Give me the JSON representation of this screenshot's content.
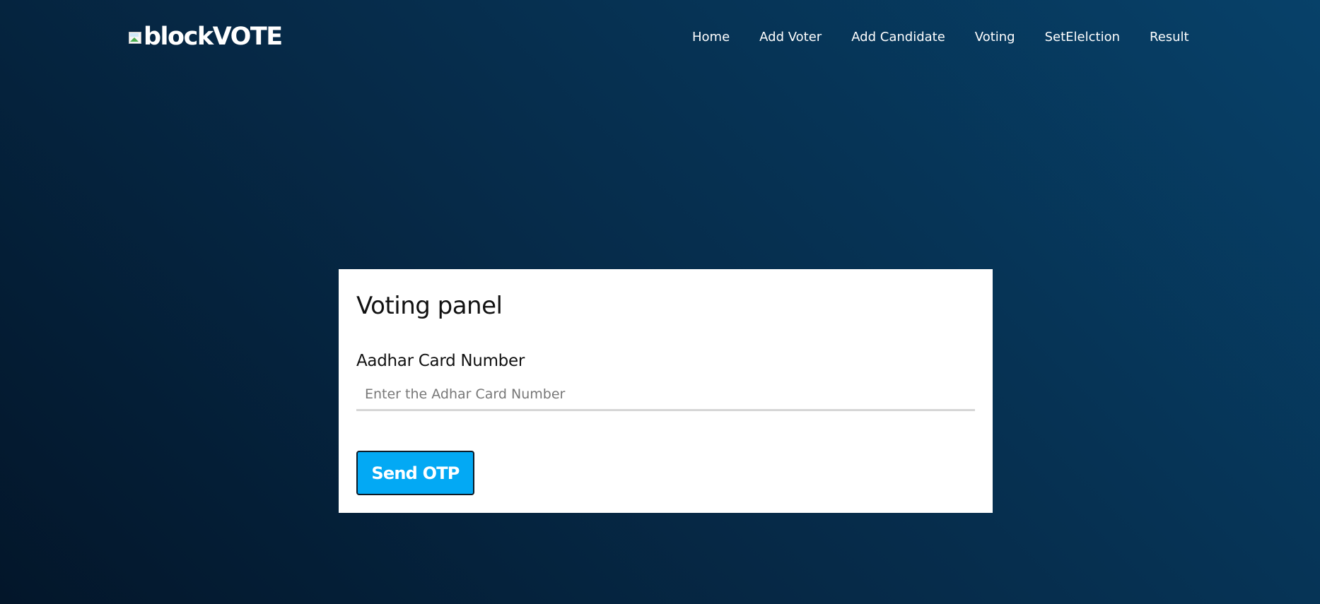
{
  "header": {
    "logo_alt_text": "blockVOTE",
    "nav": [
      {
        "label": "Home"
      },
      {
        "label": "Add Voter"
      },
      {
        "label": "Add Candidate"
      },
      {
        "label": "Voting"
      },
      {
        "label": "SetElelction"
      },
      {
        "label": "Result"
      }
    ]
  },
  "panel": {
    "title": "Voting panel",
    "aadhar_label": "Aadhar Card Number",
    "aadhar_input": {
      "value": "",
      "placeholder": "Enter the Adhar Card Number"
    },
    "send_otp_label": "Send OTP"
  },
  "colors": {
    "background_dark": "#03162a",
    "background_light": "#074169",
    "panel_background": "#ffffff",
    "button_accent": "#03a9f4",
    "button_border": "#0b1a26"
  },
  "icons": {
    "logo": "broken-image-icon"
  }
}
